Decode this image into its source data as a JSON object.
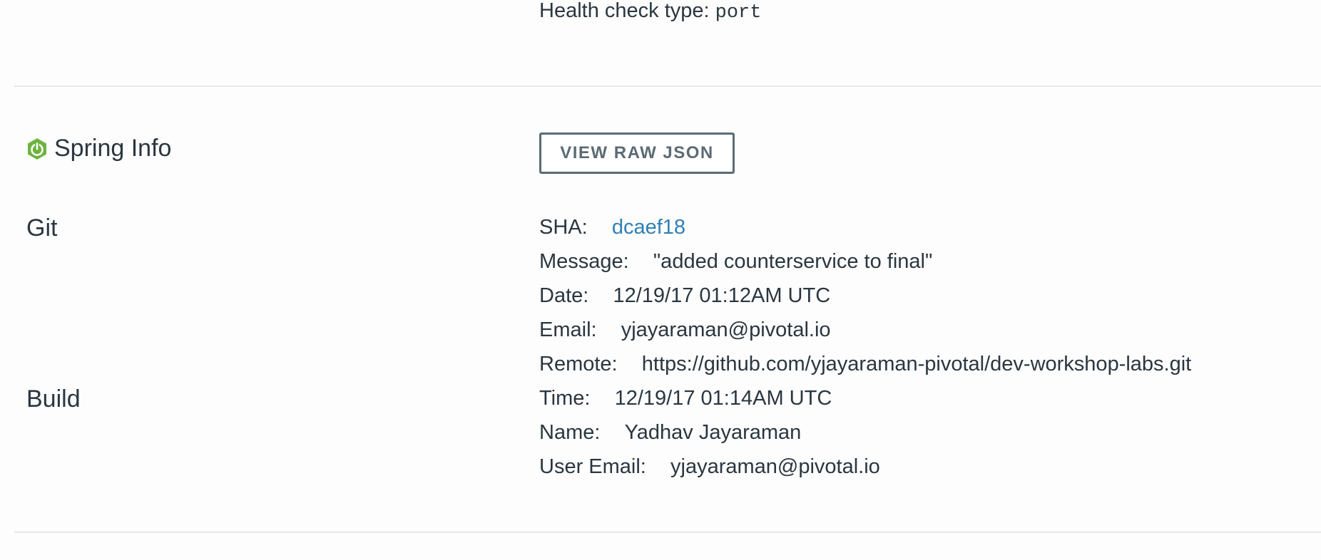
{
  "health": {
    "label": "Health check type:",
    "value": "port"
  },
  "spring_info": {
    "title": "Spring Info",
    "icon": "spring-power-icon",
    "icon_color": "#6db33f",
    "view_raw_json_label": "VIEW RAW JSON"
  },
  "git": {
    "title": "Git",
    "sha_label": "SHA:",
    "sha_value": "dcaef18",
    "message_label": "Message:",
    "message_value": "\"added counterservice to final\"",
    "date_label": "Date:",
    "date_value": "12/19/17 01:12AM UTC",
    "email_label": "Email:",
    "email_value": "yjayaraman@pivotal.io",
    "remote_label": "Remote:",
    "remote_value": "https://github.com/yjayaraman-pivotal/dev-workshop-labs.git"
  },
  "build": {
    "title": "Build",
    "time_label": "Time:",
    "time_value": "12/19/17 01:14AM UTC",
    "name_label": "Name:",
    "name_value": "Yadhav Jayaraman",
    "user_email_label": "User Email:",
    "user_email_value": "yjayaraman@pivotal.io"
  },
  "colors": {
    "link": "#2f7fb6",
    "text": "#2a3640",
    "button_border": "#5b6b75"
  }
}
